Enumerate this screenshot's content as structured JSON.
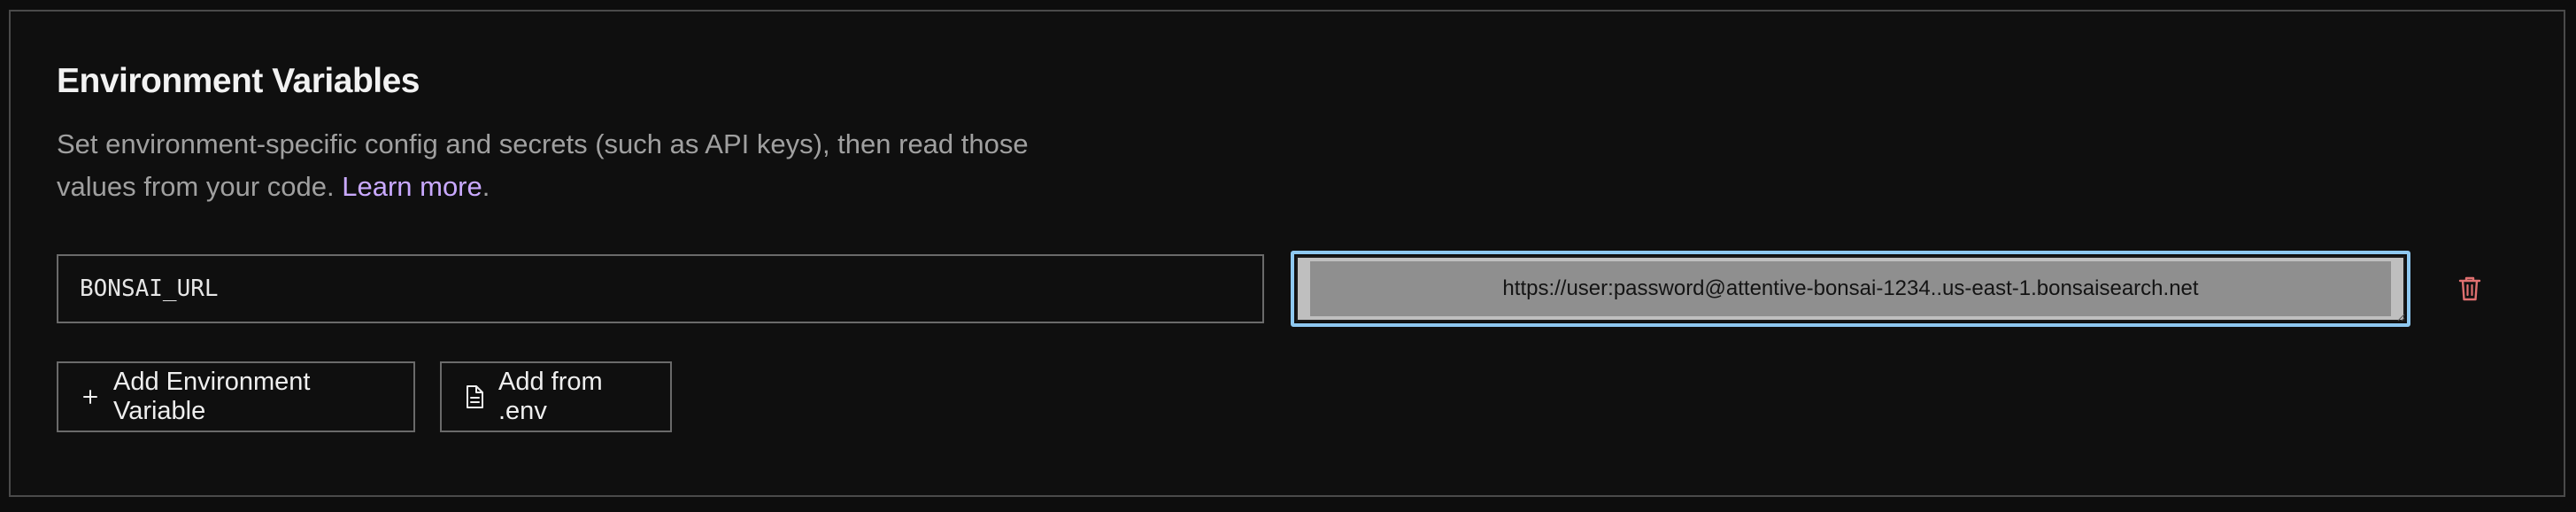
{
  "section": {
    "title": "Environment Variables",
    "description_line1": "Set environment-specific config and secrets (such as API keys), then read those",
    "description_line2": "values from your code.",
    "learn_more": "Learn more",
    "period": "."
  },
  "variable": {
    "key": "BONSAI_URL",
    "value": "https://user:password@attentive-bonsai-1234..us-east-1.bonsaisearch.net"
  },
  "actions": {
    "add_variable": "Add Environment Variable",
    "add_from_env": "Add from .env"
  },
  "icons": {
    "delete": "trash-icon",
    "add": "plus-icon",
    "file": "file-icon"
  },
  "colors": {
    "background": "#0d0d0d",
    "link": "#c9a9ff",
    "focus_ring": "#8ec8f0",
    "delete": "#e07070"
  }
}
